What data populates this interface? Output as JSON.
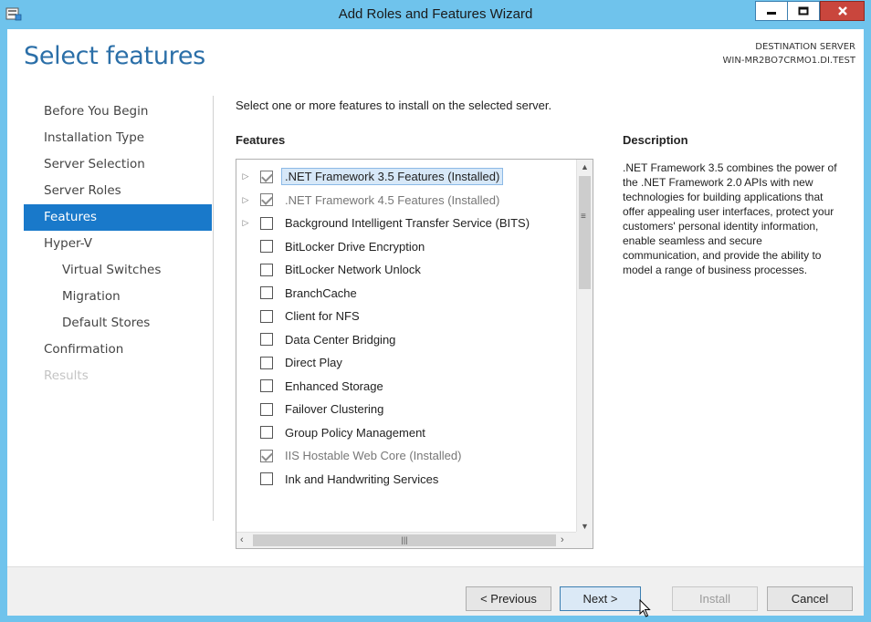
{
  "window": {
    "title": "Add Roles and Features Wizard"
  },
  "header": {
    "page_title": "Select features",
    "destination_label": "DESTINATION SERVER",
    "destination_server": "WIN-MR2BO7CRMO1.DI.TEST"
  },
  "nav": {
    "items": [
      {
        "label": "Before You Begin",
        "state": "normal"
      },
      {
        "label": "Installation Type",
        "state": "normal"
      },
      {
        "label": "Server Selection",
        "state": "normal"
      },
      {
        "label": "Server Roles",
        "state": "normal"
      },
      {
        "label": "Features",
        "state": "active"
      },
      {
        "label": "Hyper-V",
        "state": "normal"
      },
      {
        "label": "Virtual Switches",
        "state": "sub"
      },
      {
        "label": "Migration",
        "state": "sub"
      },
      {
        "label": "Default Stores",
        "state": "sub"
      },
      {
        "label": "Confirmation",
        "state": "normal"
      },
      {
        "label": "Results",
        "state": "disabled"
      }
    ]
  },
  "main": {
    "instruction": "Select one or more features to install on the selected server.",
    "features_heading": "Features",
    "features": [
      {
        "label": ".NET Framework 3.5 Features (Installed)",
        "checked": true,
        "expandable": true,
        "selected": true,
        "dim": false
      },
      {
        "label": ".NET Framework 4.5 Features (Installed)",
        "checked": true,
        "expandable": true,
        "selected": false,
        "dim": true
      },
      {
        "label": "Background Intelligent Transfer Service (BITS)",
        "checked": false,
        "expandable": true,
        "selected": false,
        "dim": false
      },
      {
        "label": "BitLocker Drive Encryption",
        "checked": false,
        "expandable": false,
        "selected": false,
        "dim": false
      },
      {
        "label": "BitLocker Network Unlock",
        "checked": false,
        "expandable": false,
        "selected": false,
        "dim": false
      },
      {
        "label": "BranchCache",
        "checked": false,
        "expandable": false,
        "selected": false,
        "dim": false
      },
      {
        "label": "Client for NFS",
        "checked": false,
        "expandable": false,
        "selected": false,
        "dim": false
      },
      {
        "label": "Data Center Bridging",
        "checked": false,
        "expandable": false,
        "selected": false,
        "dim": false
      },
      {
        "label": "Direct Play",
        "checked": false,
        "expandable": false,
        "selected": false,
        "dim": false
      },
      {
        "label": "Enhanced Storage",
        "checked": false,
        "expandable": false,
        "selected": false,
        "dim": false
      },
      {
        "label": "Failover Clustering",
        "checked": false,
        "expandable": false,
        "selected": false,
        "dim": false
      },
      {
        "label": "Group Policy Management",
        "checked": false,
        "expandable": false,
        "selected": false,
        "dim": false
      },
      {
        "label": "IIS Hostable Web Core (Installed)",
        "checked": true,
        "expandable": false,
        "selected": false,
        "dim": true
      },
      {
        "label": "Ink and Handwriting Services",
        "checked": false,
        "expandable": false,
        "selected": false,
        "dim": false
      }
    ],
    "description_heading": "Description",
    "description_text": ".NET Framework 3.5 combines the power of the .NET Framework 2.0 APIs with new technologies for building applications that offer appealing user interfaces, protect your customers' personal identity information, enable seamless and secure communication, and provide the ability to model a range of business processes."
  },
  "footer": {
    "previous_label": "< Previous",
    "next_label": "Next >",
    "install_label": "Install",
    "cancel_label": "Cancel"
  },
  "colors": {
    "title_bar": "#6fc3ec",
    "accent": "#1979ca",
    "page_title": "#2b6fa8",
    "close_button": "#c9463d"
  }
}
